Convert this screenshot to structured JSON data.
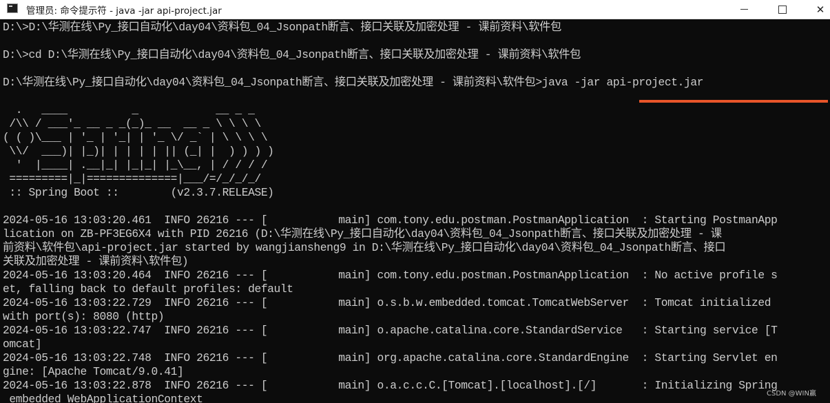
{
  "window": {
    "title": "管理员: 命令提示符 - java  -jar api-project.jar",
    "minimize_label": "—",
    "maximize_label": "",
    "close_label": "✕",
    "icon": "cmd-icon"
  },
  "console": {
    "lines": [
      "D:\\>D:\\华测在线\\Py_接口自动化\\day04\\资料包_04_Jsonpath断言、接口关联及加密处理 - 课前资料\\软件包",
      "",
      "D:\\>cd D:\\华测在线\\Py_接口自动化\\day04\\资料包_04_Jsonpath断言、接口关联及加密处理 - 课前资料\\软件包",
      "",
      "D:\\华测在线\\Py_接口自动化\\day04\\资料包_04_Jsonpath断言、接口关联及加密处理 - 课前资料\\软件包>java -jar api-project.jar",
      "",
      "  .   ____          _            __ _ _",
      " /\\\\ / ___'_ __ _ _(_)_ __  __ _ \\ \\ \\ \\",
      "( ( )\\___ | '_ | '_| | '_ \\/ _` | \\ \\ \\ \\",
      " \\\\/  ___)| |_)| | | | | || (_| |  ) ) ) )",
      "  '  |____| .__|_| |_|_| |_\\__, | / / / /",
      " =========|_|==============|___/=/_/_/_/",
      " :: Spring Boot ::        (v2.3.7.RELEASE)",
      "",
      "2024-05-16 13:03:20.461  INFO 26216 --- [           main] com.tony.edu.postman.PostmanApplication  : Starting PostmanApp",
      "lication on ZB-PF3EG6X4 with PID 26216 (D:\\华测在线\\Py_接口自动化\\day04\\资料包_04_Jsonpath断言、接口关联及加密处理 - 课",
      "前资料\\软件包\\api-project.jar started by wangjiansheng9 in D:\\华测在线\\Py_接口自动化\\day04\\资料包_04_Jsonpath断言、接口",
      "关联及加密处理 - 课前资料\\软件包)",
      "2024-05-16 13:03:20.464  INFO 26216 --- [           main] com.tony.edu.postman.PostmanApplication  : No active profile s",
      "et, falling back to default profiles: default",
      "2024-05-16 13:03:22.729  INFO 26216 --- [           main] o.s.b.w.embedded.tomcat.TomcatWebServer  : Tomcat initialized",
      "with port(s): 8080 (http)",
      "2024-05-16 13:03:22.747  INFO 26216 --- [           main] o.apache.catalina.core.StandardService   : Starting service [T",
      "omcat]",
      "2024-05-16 13:03:22.748  INFO 26216 --- [           main] org.apache.catalina.core.StandardEngine  : Starting Servlet en",
      "gine: [Apache Tomcat/9.0.41]",
      "2024-05-16 13:03:22.878  INFO 26216 --- [           main] o.a.c.c.C.[Tomcat].[localhost].[/]       : Initializing Spring",
      " embedded WebApplicationContext"
    ]
  },
  "highlight": {
    "color": "#e8552a"
  },
  "watermark": "CSDN @WIN赢"
}
